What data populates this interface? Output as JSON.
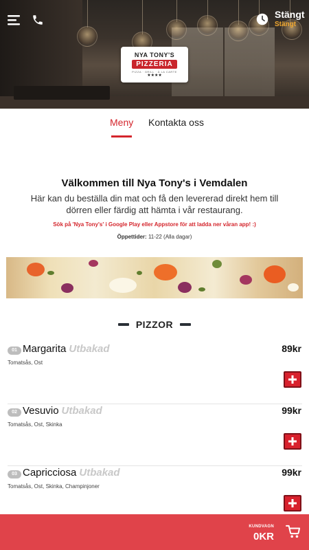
{
  "header": {
    "status": "Stängt",
    "status_sub": "Stängt",
    "logo": {
      "top": "NYA TONY'S",
      "main": "PIZZERIA",
      "sub": "PIZZA · GRILL · À LA CARTE",
      "stars": "★★★★"
    },
    "icons": [
      "menu-icon",
      "phone-icon",
      "clock-icon"
    ]
  },
  "tabs": [
    {
      "label": "Meny",
      "active": true
    },
    {
      "label": "Kontakta oss",
      "active": false
    }
  ],
  "intro": {
    "title": "Välkommen till Nya Tony's i Vemdalen",
    "text": "Här kan du beställa din mat och få den levererad direkt hem till dörren eller färdig att hämta i vår restaurang.",
    "app_notice": "Sök på 'Nya Tony's' i Google Play eller Appstore för att ladda ner våran app! :)",
    "hours_label": "Öppettider:",
    "hours_value": "11-22 (Alla dagar)"
  },
  "section": {
    "title": "PIZZOR"
  },
  "products": [
    {
      "num": "01",
      "name": "Margarita",
      "tag": "Utbakad",
      "desc": "Tomatsås, Ost",
      "price": "89kr"
    },
    {
      "num": "02",
      "name": "Vesuvio",
      "tag": "Utbakad",
      "desc": "Tomatsås, Ost, Skinka",
      "price": "99kr"
    },
    {
      "num": "03",
      "name": "Capricciosa",
      "tag": "Utbakad",
      "desc": "Tomatsås, Ost, Skinka, Champinjoner",
      "price": "99kr"
    }
  ],
  "cart": {
    "label": "KUNDVAGN",
    "total": "0KR"
  },
  "colors": {
    "accent": "#d4252c",
    "cart_bg": "#e0434a",
    "status_closed": "#f0a830"
  }
}
